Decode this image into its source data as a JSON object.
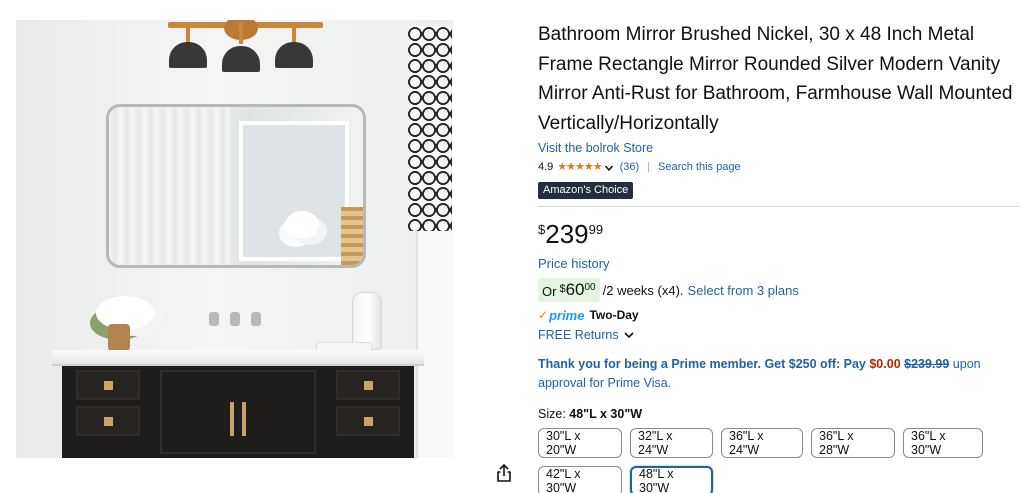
{
  "product": {
    "title": "Bathroom Mirror Brushed Nickel, 30 x 48 Inch Metal Frame Rectangle Mirror Rounded Silver Modern Vanity Mirror Anti-Rust for Bathroom, Farmhouse Wall Mounted Vertically/Horizontally",
    "store_link": "Visit the bolrok Store",
    "rating": {
      "value": "4.9",
      "stars": "★★★★★",
      "count": "(36)",
      "separator": "|",
      "search_link": "Search this page"
    },
    "badge": "Amazon's Choice"
  },
  "price": {
    "symbol": "$",
    "whole": "239",
    "fraction": "99",
    "history_link": "Price history"
  },
  "installment": {
    "prefix": "Or",
    "symbol": "$",
    "whole": "60",
    "fraction": "00",
    "term": "/2 weeks (x4).",
    "plans_link": "Select from 3 plans"
  },
  "delivery": {
    "prime_check": "✓",
    "prime_word": "prime",
    "prime_speed": "Two-Day",
    "returns_link": "FREE Returns"
  },
  "promo": {
    "lead": "Thank you for being a Prime member. Get $250 off: Pay",
    "zero": "$0.00",
    "strike": "$239.99",
    "tail": "upon approval for Prime Visa."
  },
  "size": {
    "label": "Size:",
    "selected": "48\"L x 30\"W",
    "options": [
      "30\"L x 20\"W",
      "32\"L x 24\"W",
      "36\"L x 24\"W",
      "36\"L x 28\"W",
      "36\"L x 30\"W",
      "42\"L x 30\"W",
      "48\"L x 30\"W"
    ]
  },
  "icons": {
    "share": "share-icon",
    "rating_chevron": "chevron-down-icon",
    "returns_chevron": "chevron-down-icon"
  },
  "colors": {
    "link": "#2162a1",
    "star": "#de7921",
    "badge_bg": "#232f3e",
    "installment_bg": "#e3f5e1",
    "promo_red": "#b12704",
    "prime_blue": "#1a98ff"
  }
}
